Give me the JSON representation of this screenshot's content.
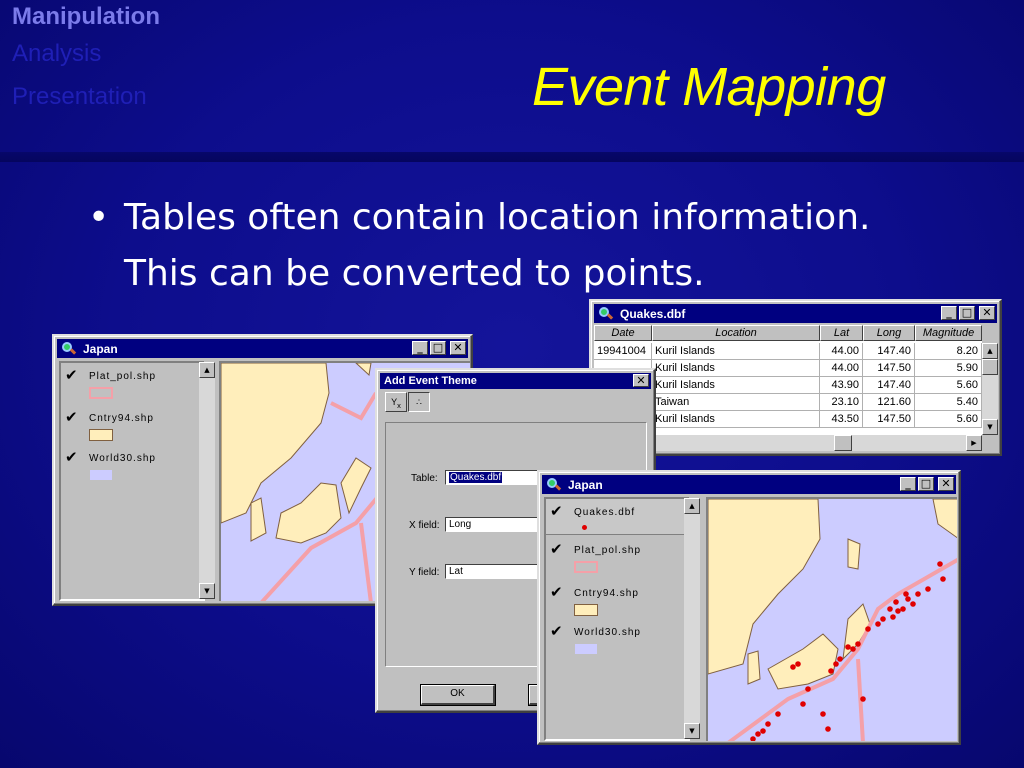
{
  "nav": {
    "items": [
      "Manipulation",
      "Analysis",
      "Presentation"
    ]
  },
  "slide": {
    "title": "Event Mapping",
    "bullet_line1": "Tables often contain location information.",
    "bullet_line2": "This can be converted to points."
  },
  "window_japan1": {
    "title": "Japan",
    "legend": [
      {
        "label": "Plat_pol.shp",
        "checked": true,
        "symbol": "pink-outline"
      },
      {
        "label": "Cntry94.shp",
        "checked": true,
        "symbol": "yellow-fill"
      },
      {
        "label": "World30.shp",
        "checked": true,
        "symbol": "lavender-fill"
      }
    ]
  },
  "window_quakes": {
    "title": "Quakes.dbf",
    "columns": [
      "Date",
      "Location",
      "Lat",
      "Long",
      "Magnitude"
    ],
    "rows": [
      [
        "19941004",
        "Kuril Islands",
        "44.00",
        "147.40",
        "8.20"
      ],
      [
        "",
        "Kuril Islands",
        "44.00",
        "147.50",
        "5.90"
      ],
      [
        "",
        "Kuril Islands",
        "43.90",
        "147.40",
        "5.60"
      ],
      [
        "",
        "Taiwan",
        "23.10",
        "121.60",
        "5.40"
      ],
      [
        "",
        "Kuril Islands",
        "43.50",
        "147.50",
        "5.60"
      ]
    ]
  },
  "dialog": {
    "title": "Add Event Theme",
    "table_label": "Table:",
    "table_value": "Quakes.dbf",
    "xfield_label": "X field:",
    "xfield_value": "Long",
    "yfield_label": "Y field:",
    "yfield_value": "Lat",
    "ok_label": "OK"
  },
  "window_japan2": {
    "title": "Japan",
    "legend": [
      {
        "label": "Quakes.dbf",
        "checked": true,
        "symbol": "red-dot"
      },
      {
        "label": "Plat_pol.shp",
        "checked": true,
        "symbol": "pink-outline"
      },
      {
        "label": "Cntry94.shp",
        "checked": true,
        "symbol": "yellow-fill"
      },
      {
        "label": "World30.shp",
        "checked": true,
        "symbol": "lavender-fill"
      }
    ]
  },
  "colors": {
    "background": "#0c0c8a",
    "title": "#ffff00",
    "nav_active": "#7b7bea",
    "nav_dim": "#1f1fb6",
    "titlebar": "#000080",
    "water": "#ccccff",
    "land": "#ffeebb",
    "plate": "#f4a0a8",
    "quake": "#e00000"
  },
  "icons": {
    "window": "map-magnifier-icon",
    "minimize": "minimize-icon",
    "maximize": "maximize-icon",
    "close": "close-icon",
    "check": "checkmark-icon"
  }
}
